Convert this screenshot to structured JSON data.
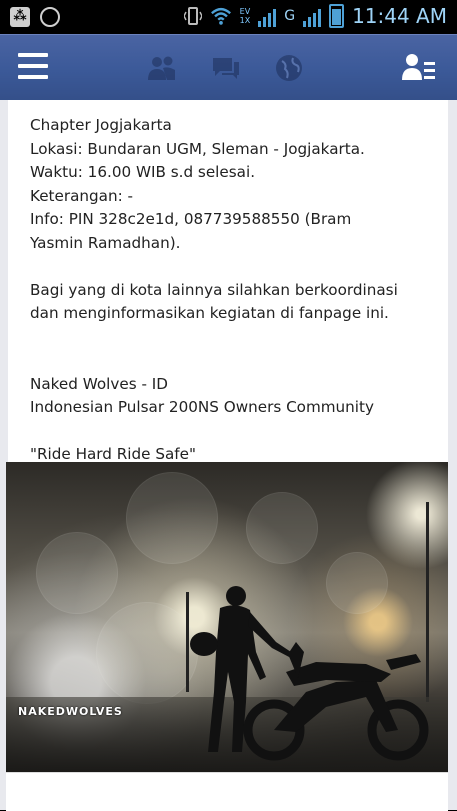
{
  "status_bar": {
    "time": "11:44 AM",
    "net1": "EV",
    "net2": "1X",
    "net3": "G"
  },
  "app_bar": {
    "icons": [
      "menu-icon",
      "friend-requests-icon",
      "messages-icon",
      "notifications-globe-icon",
      "people-list-icon"
    ],
    "color": "#3b5998"
  },
  "post": {
    "lines1": [
      "Chapter Jogjakarta",
      "Lokasi: Bundaran UGM, Sleman - Jogjakarta.",
      "Waktu: 16.00 WIB s.d selesai.",
      "Keterangan: -",
      "Info: PIN 328c2e1d, 087739588550 (Bram",
      "Yasmin Ramadhan)."
    ],
    "lines2": [
      "Bagi yang di kota lainnya silahkan berkoordinasi",
      "dan menginformasikan kegiatan di fanpage ini."
    ],
    "lines3": [
      "Naked Wolves - ID",
      "Indonesian Pulsar 200NS Owners Community"
    ],
    "tagline": "\"Ride Hard Ride Safe\""
  },
  "photo": {
    "watermark": "NAKEDWOLVES"
  }
}
